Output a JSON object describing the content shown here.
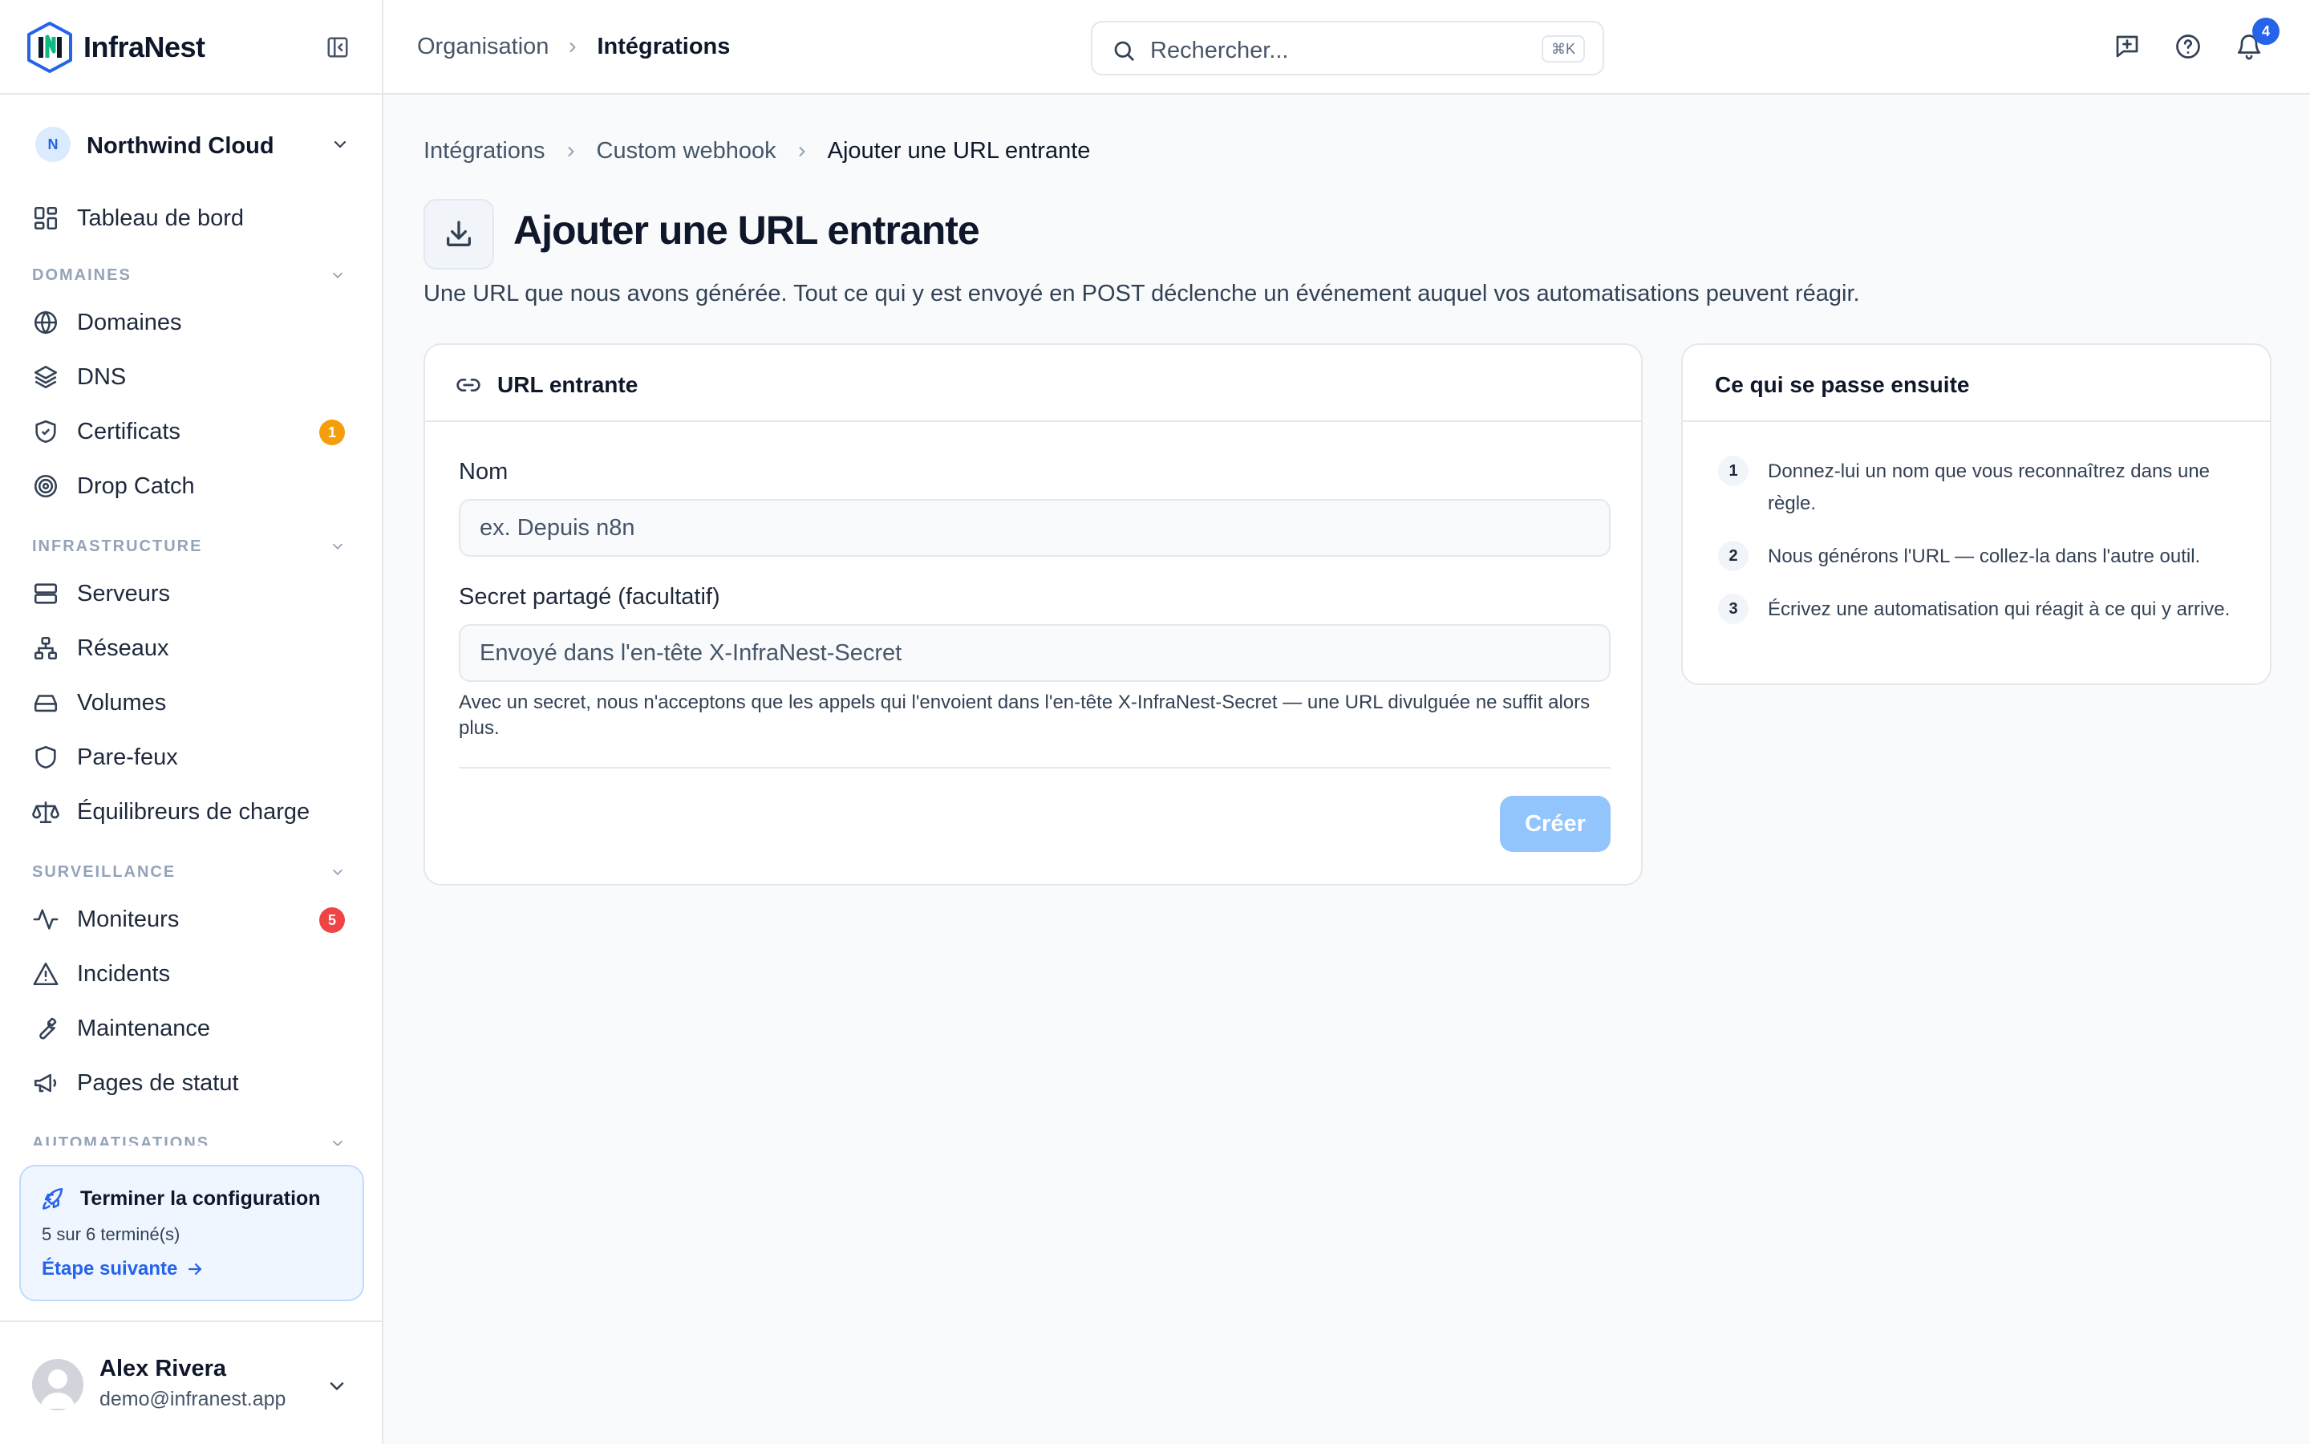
{
  "app": {
    "name": "InfraNest"
  },
  "org": {
    "initial": "N",
    "name": "Northwind Cloud"
  },
  "nav": {
    "dashboard": "Tableau de bord",
    "sections": {
      "domains": "DOMAINES",
      "infra": "INFRASTRUCTURE",
      "monitoring": "SURVEILLANCE",
      "automation": "AUTOMATISATIONS"
    },
    "items": {
      "domains": "Domaines",
      "dns": "DNS",
      "certificates": "Certificats",
      "dropcatch": "Drop Catch",
      "servers": "Serveurs",
      "networks": "Réseaux",
      "volumes": "Volumes",
      "firewalls": "Pare-feux",
      "loadbalancers": "Équilibreurs de charge",
      "monitors": "Moniteurs",
      "incidents": "Incidents",
      "maintenance": "Maintenance",
      "statuspages": "Pages de statut"
    },
    "badges": {
      "certificates": "1",
      "monitors": "5"
    }
  },
  "setup": {
    "title": "Terminer la configuration",
    "progress": "5 sur 6 terminé(s)",
    "next": "Étape suivante"
  },
  "user": {
    "name": "Alex Rivera",
    "email": "demo@infranest.app"
  },
  "topbar": {
    "crumbs": [
      "Organisation",
      "Intégrations"
    ],
    "search_placeholder": "Rechercher...",
    "search_kbd": "⌘K",
    "notif_count": "4"
  },
  "breadcrumb": [
    "Intégrations",
    "Custom webhook",
    "Ajouter une URL entrante"
  ],
  "page": {
    "title": "Ajouter une URL entrante",
    "description": "Une URL que nous avons générée. Tout ce qui y est envoyé en POST déclenche un événement auquel vos automatisations peuvent réagir."
  },
  "form": {
    "card_title": "URL entrante",
    "name_label": "Nom",
    "name_placeholder": "ex. Depuis n8n",
    "secret_label": "Secret partagé (facultatif)",
    "secret_placeholder": "Envoyé dans l'en-tête X-InfraNest-Secret",
    "secret_help": "Avec un secret, nous n'acceptons que les appels qui l'envoient dans l'en-tête X-InfraNest-Secret — une URL divulguée ne suffit alors plus.",
    "submit": "Créer"
  },
  "next_steps": {
    "title": "Ce qui se passe ensuite",
    "steps": [
      {
        "n": "1",
        "text": "Donnez-lui un nom que vous reconnaîtrez dans une règle."
      },
      {
        "n": "2",
        "text": "Nous générons l'URL — collez-la dans l'autre outil."
      },
      {
        "n": "3",
        "text": "Écrivez une automatisation qui réagit à ce qui y arrive."
      }
    ]
  },
  "colors": {
    "accent": "#2563eb",
    "badge_warning": "#f59e0b",
    "badge_danger": "#ef4444",
    "button_disabled": "#93c5fd"
  }
}
